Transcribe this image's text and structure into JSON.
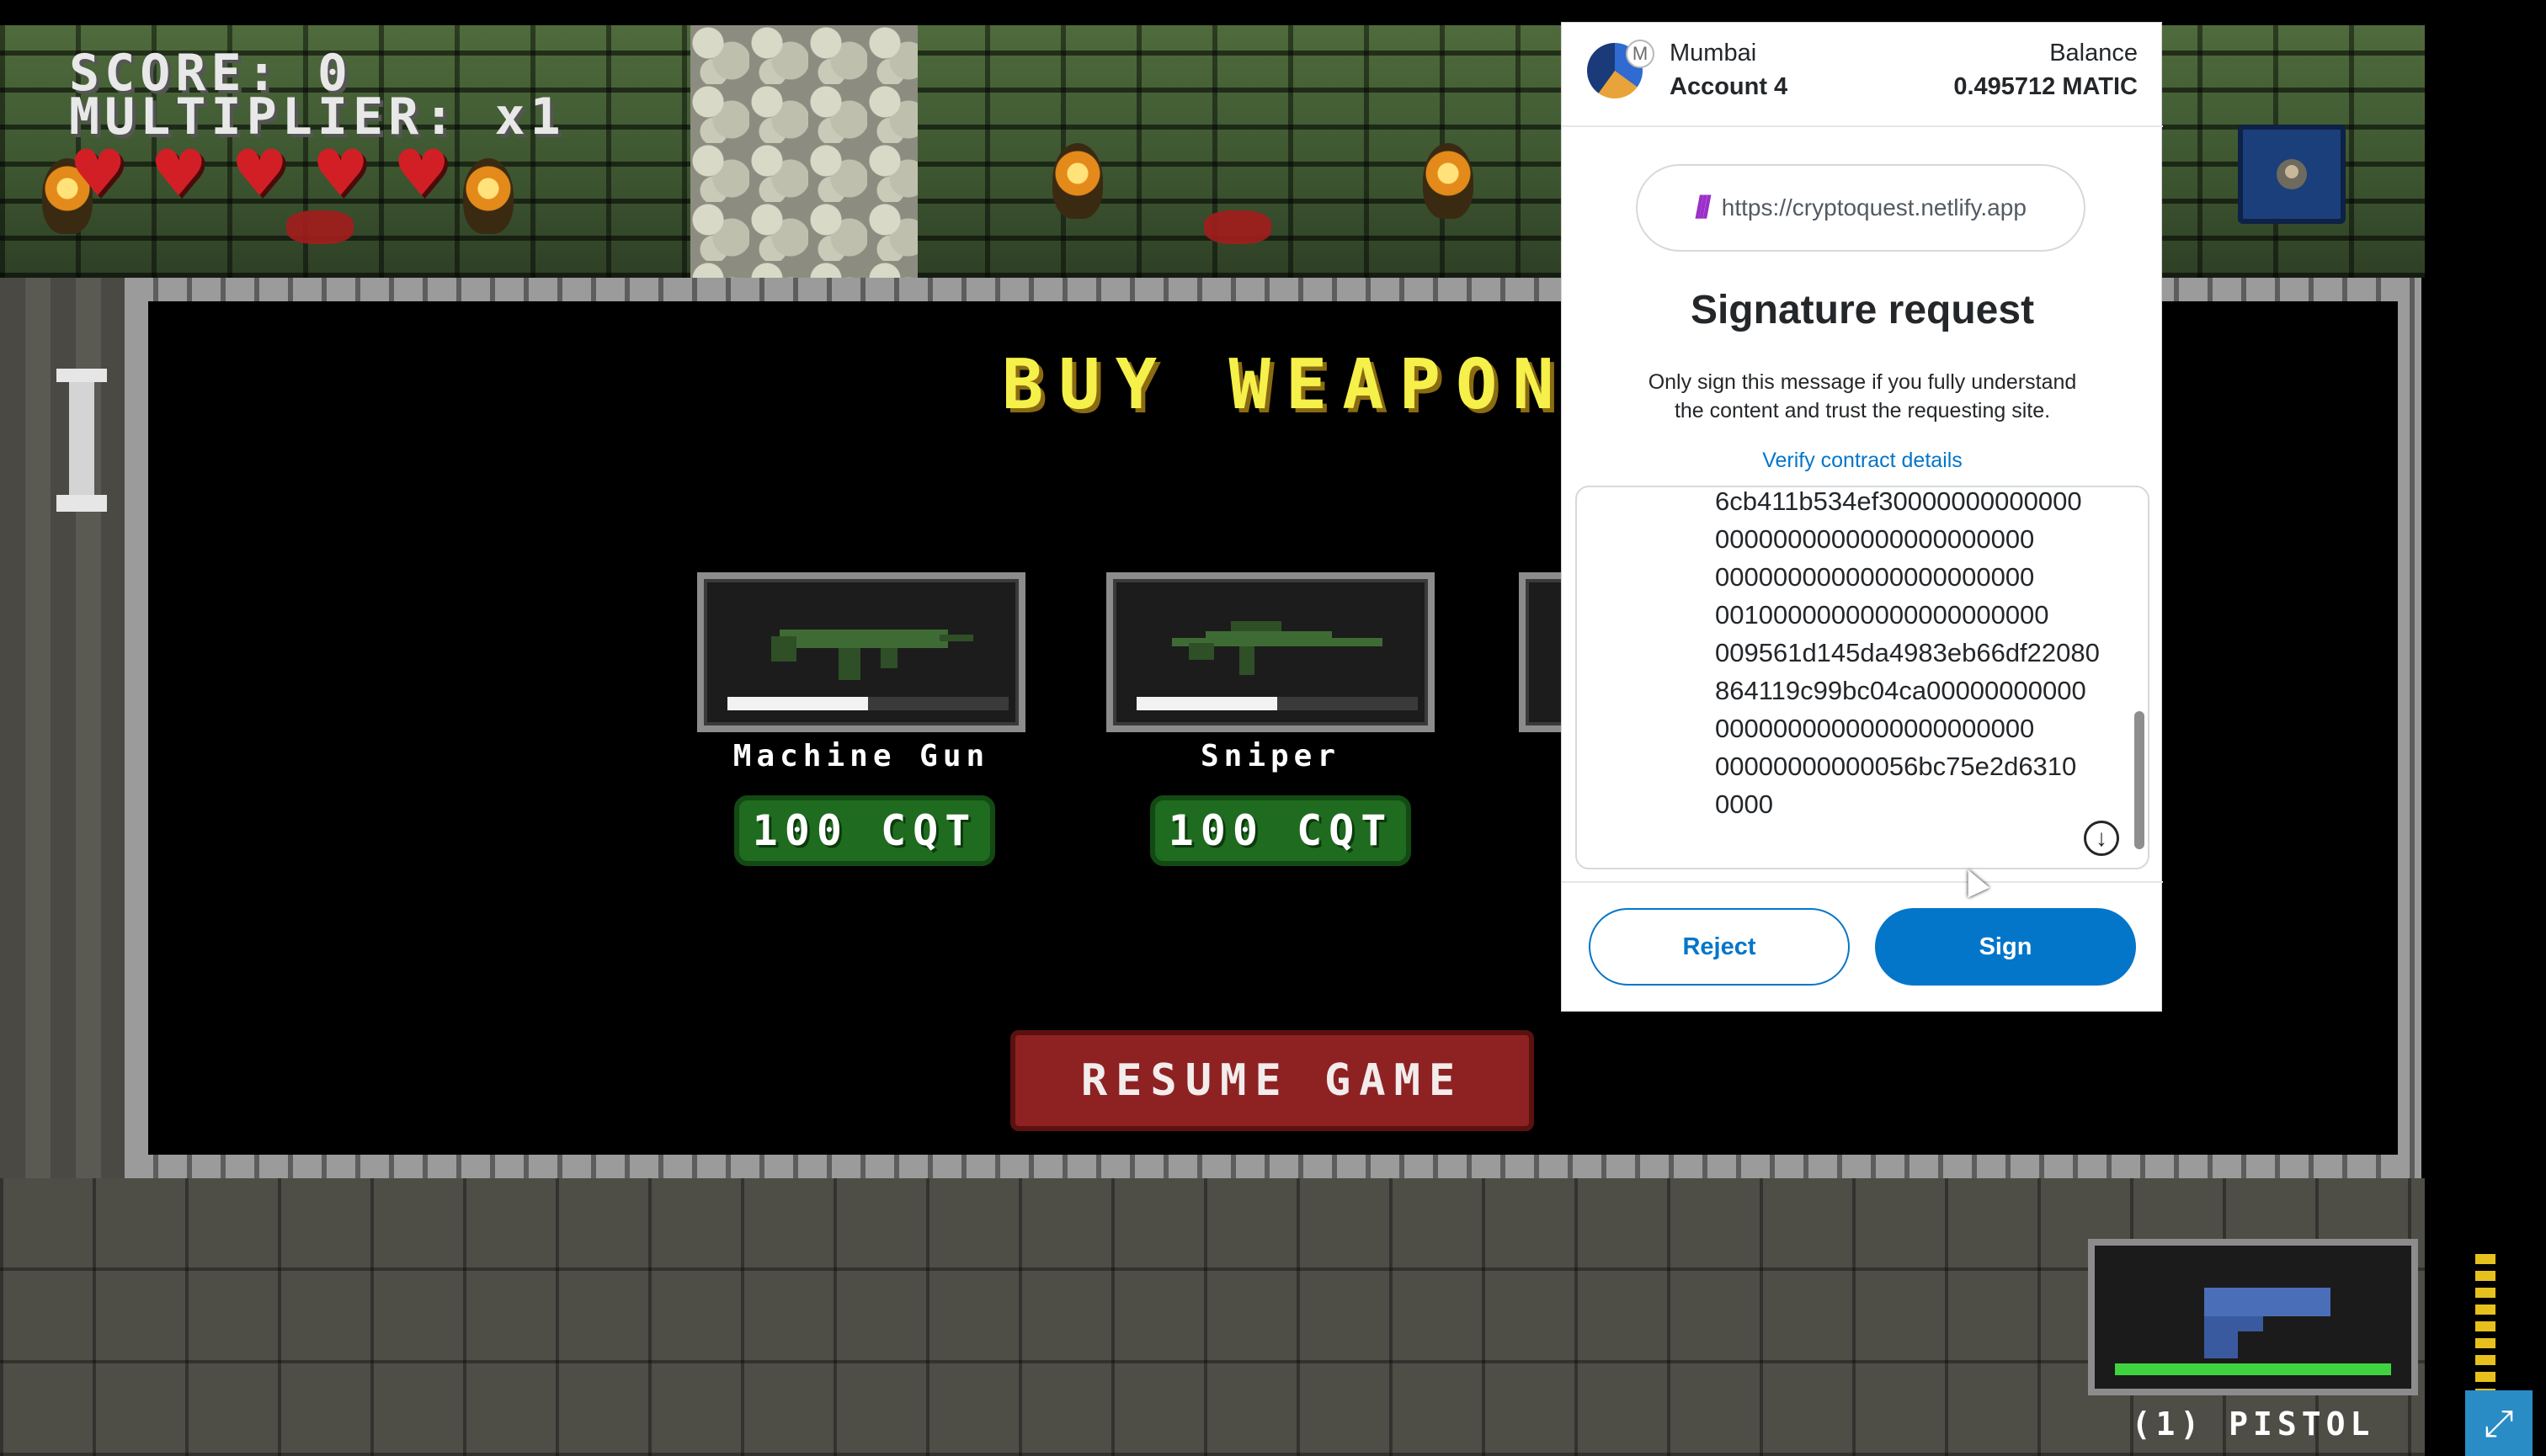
{
  "hud": {
    "score": "SCORE: 0",
    "multiplier": "MULTIPLIER: x1",
    "hearts": 5
  },
  "shop": {
    "title": "BUY WEAPON",
    "weapons": [
      {
        "name": "Machine Gun",
        "price": "100 CQT",
        "ammo_fraction": 0.5
      },
      {
        "name": "Sniper",
        "price": "100 CQT",
        "ammo_fraction": 0.5
      }
    ],
    "resume_label": "RESUME GAME"
  },
  "current_weapon": {
    "label": "(1) PISTOL",
    "health_fraction": 1.0
  },
  "icons": {
    "heart": "heart-icon",
    "map": "map-icon",
    "fullscreen": "fullscreen-icon",
    "scroll_down": "arrow-down-icon"
  },
  "wallet": {
    "network": "Mumbai",
    "network_badge": "M",
    "account": "Account 4",
    "balance_label": "Balance",
    "balance_value": "0.495712 MATIC",
    "origin": "https://cryptoquest.netlify.app",
    "title": "Signature request",
    "warning": "Only sign this message if you fully understand the content and trust the requesting site.",
    "verify_link": "Verify contract details",
    "message_lines": [
      "6cb411b534ef30000000000000",
      "0000000000000000000000",
      "0000000000000000000000",
      "00100000000000000000000",
      "009561d145da4983eb66df22080",
      "864119c99bc04ca00000000000",
      "0000000000000000000000",
      "00000000000056bc75e2d6310",
      "0000"
    ],
    "reject_label": "Reject",
    "sign_label": "Sign",
    "colors": {
      "primary": "#0376c9",
      "text": "#24272a"
    }
  }
}
